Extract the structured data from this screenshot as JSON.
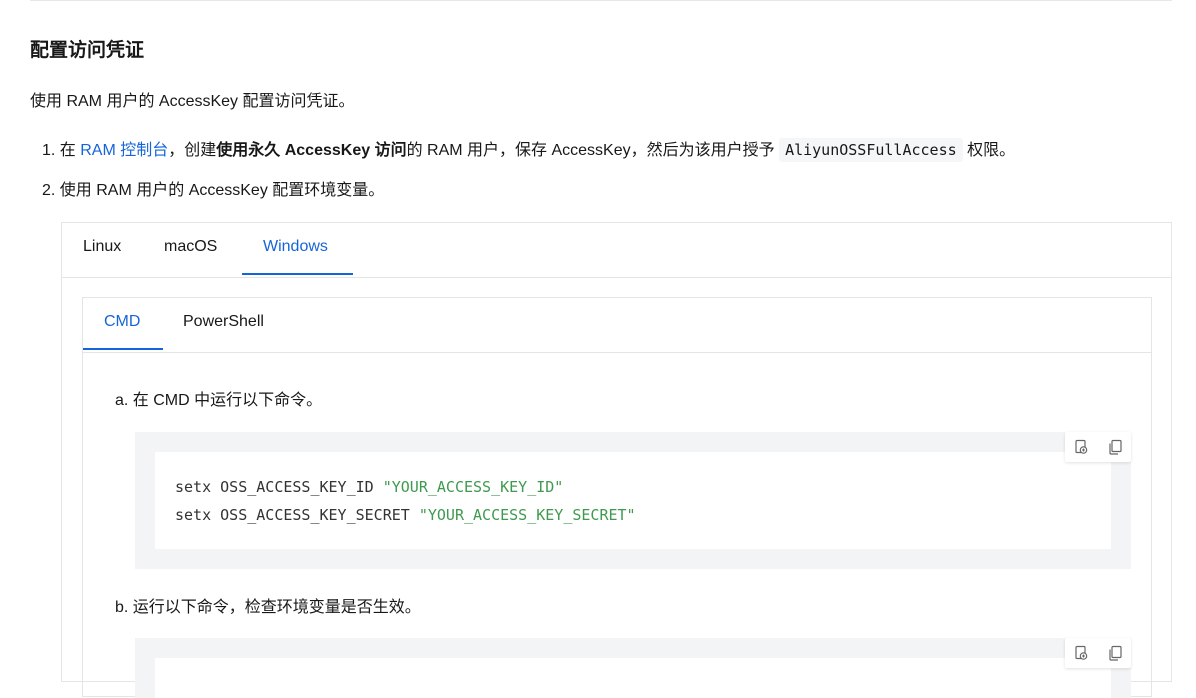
{
  "heading": "配置访问凭证",
  "intro": "使用 RAM 用户的 AccessKey 配置访问凭证。",
  "steps": {
    "s1": {
      "num": "1.",
      "pre": "在 ",
      "link": "RAM 控制台",
      "mid": "，创建",
      "bold": "使用永久 AccessKey 访问",
      "post": "的 RAM 用户，保存 AccessKey，然后为该用户授予 ",
      "code": "AliyunOSSFullAccess",
      "tail": " 权限。"
    },
    "s2": {
      "num": "2.",
      "text": "使用 RAM 用户的 AccessKey 配置环境变量。"
    }
  },
  "outer_tabs": [
    "Linux",
    "macOS",
    "Windows"
  ],
  "outer_active": "Windows",
  "inner_tabs": [
    "CMD",
    "PowerShell"
  ],
  "inner_active": "CMD",
  "substeps": {
    "a": "a. 在 CMD 中运行以下命令。",
    "b": "b. 运行以下命令，检查环境变量是否生效。"
  },
  "code_a": {
    "line1": {
      "cmd": "setx OSS_ACCESS_KEY_ID ",
      "str": "\"YOUR_ACCESS_KEY_ID\""
    },
    "line2": {
      "cmd": "setx OSS_ACCESS_KEY_SECRET ",
      "str": "\"YOUR_ACCESS_KEY_SECRET\""
    }
  },
  "icons": {
    "copy_to_editor": "copy-to-editor-icon",
    "copy": "copy-icon"
  },
  "colors": {
    "accent": "#1665d8",
    "string": "#3f9a4f"
  }
}
